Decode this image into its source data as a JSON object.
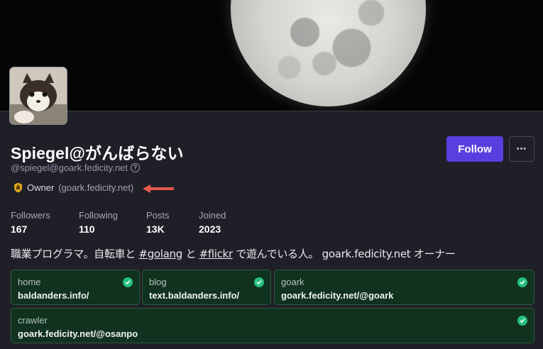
{
  "profile": {
    "display_name": "Spiegel@がんばらない",
    "account": "@spiegel@goark.fedicity.net",
    "help_glyph": "?",
    "role_name": "Owner",
    "role_server": "(goark.fedicity.net)"
  },
  "actions": {
    "follow_label": "Follow",
    "more_label": "•••"
  },
  "stats": [
    {
      "label": "Followers",
      "value": "167"
    },
    {
      "label": "Following",
      "value": "110"
    },
    {
      "label": "Posts",
      "value": "13K"
    },
    {
      "label": "Joined",
      "value": "2023"
    }
  ],
  "bio": {
    "part1": "職業プログラマ。自転車と ",
    "tag1": "#golang",
    "part2": " と ",
    "tag2": "#flickr",
    "part3": " で遊んでいる人。 goark.fedicity.net オーナー"
  },
  "fields": [
    {
      "name": "home",
      "value": "baldanders.info/"
    },
    {
      "name": "blog",
      "value": "text.baldanders.info/"
    },
    {
      "name": "goark",
      "value": "goark.fedicity.net/@goark"
    },
    {
      "name": "crawler",
      "value": "goark.fedicity.net/@osanpo"
    }
  ],
  "colors": {
    "accent": "#5b3ee0",
    "verified": "#27c083",
    "field_bg": "#10321f",
    "annotation_arrow": "#e8584c"
  },
  "icons": {
    "role": "owner-badge-icon",
    "verified": "check-circle-icon",
    "help": "help-circle-icon",
    "more": "ellipsis-icon",
    "annotation": "arrow-left-icon"
  }
}
